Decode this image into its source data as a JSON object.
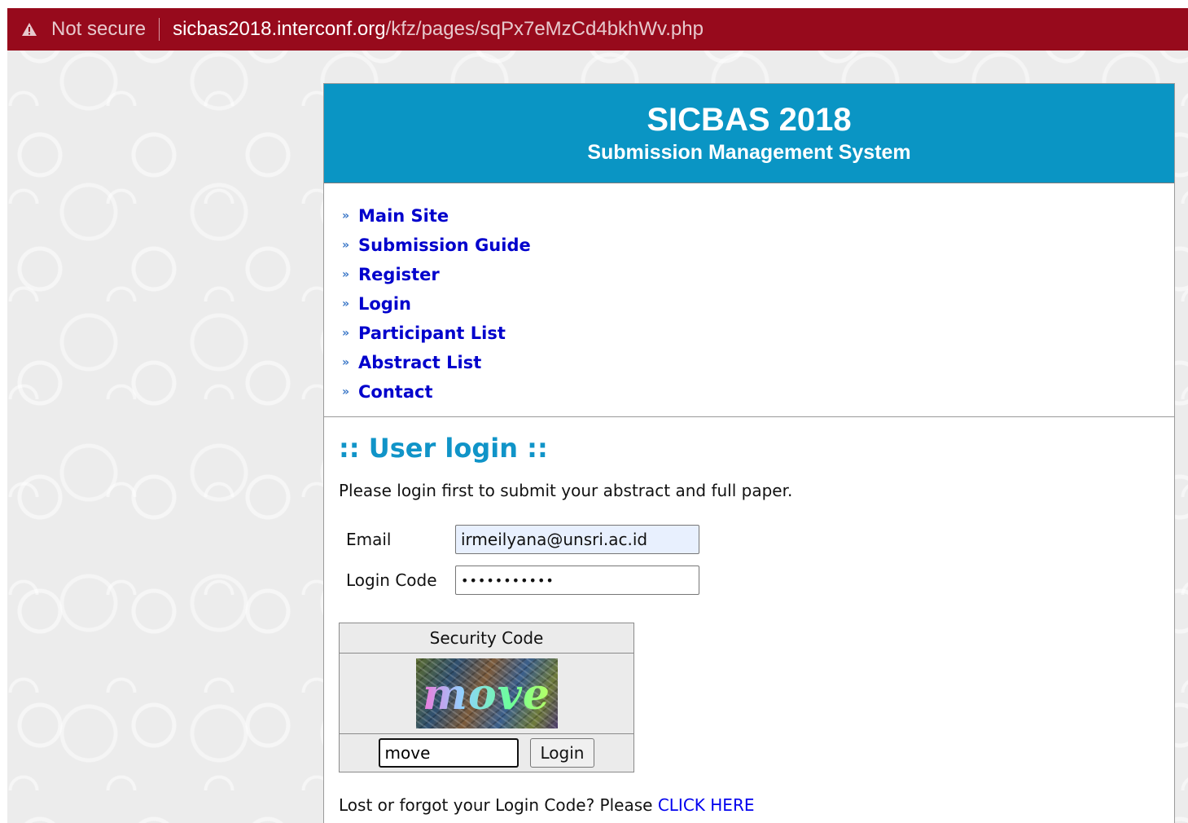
{
  "browser": {
    "security_label": "Not secure",
    "url_host": "sicbas2018.interconf.org",
    "url_path": "/kfz/pages/sqPx7eMzCd4bkhWv.php",
    "bar_color": "#970a1c"
  },
  "header": {
    "title": "SICBAS 2018",
    "subtitle": "Submission Management System",
    "bg_color": "#0a95c4"
  },
  "nav": {
    "bullet": "»",
    "items": [
      {
        "label": "Main Site"
      },
      {
        "label": "Submission Guide"
      },
      {
        "label": "Register"
      },
      {
        "label": "Login"
      },
      {
        "label": "Participant List"
      },
      {
        "label": "Abstract List"
      },
      {
        "label": "Contact"
      }
    ]
  },
  "login": {
    "title": ":: User login ::",
    "intro": "Please login first to submit your abstract and full paper.",
    "email_label": "Email",
    "email_value": "irmeilyana@unsri.ac.id",
    "code_label": "Login Code",
    "code_masked": "•••••••••••",
    "captcha_header": "Security Code",
    "captcha_word": "move",
    "captcha_input_value": "move",
    "login_button": "Login",
    "forgot_text": "Lost or forgot your Login Code? Please",
    "forgot_link": "CLICK HERE"
  }
}
